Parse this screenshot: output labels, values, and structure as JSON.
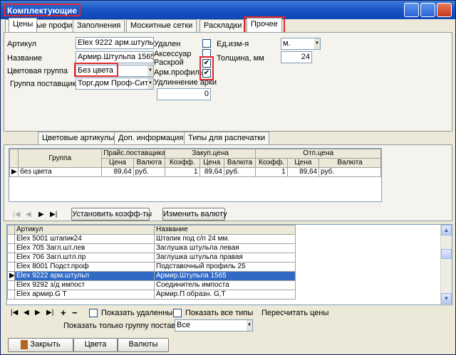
{
  "window": {
    "title": "Комплектующие"
  },
  "tabs": [
    "Основные профили",
    "Заполнения",
    "Москитные сетки",
    "Раскладки",
    "Прочее"
  ],
  "form": {
    "article_label": "Артикул",
    "article_value": "Elex 9222 арм.штульп",
    "name_label": "Название",
    "name_value": "Армир.Штульпа 1565",
    "color_group_label": "Цветовая группа",
    "color_group_value": "Без цвета",
    "supplier_group_label": "Группа поставщика",
    "supplier_group_value": "Торг.дом Проф-Сити",
    "deleted_label": "Удален",
    "accessory_label": "Аксессуар",
    "cutting_label": "Раскрой",
    "arm_profile_label": "Арм.профиль",
    "arc_extension_label": "Удлиннение арки",
    "arc_extension_value": "0",
    "unit_label": "Ед.изм-я",
    "unit_value": "м.",
    "thickness_label": "Толщина, мм",
    "thickness_value": "24",
    "deleted_checked": false,
    "accessory_checked": false,
    "cutting_checked": true,
    "arm_profile_checked": true
  },
  "subtabs": [
    "Цены",
    "Цветовые артикулы",
    "Доп. информация",
    "Типы для распечатки"
  ],
  "price_grid": {
    "group_header": "Группа",
    "supplier_price_header": "Прайс.поставщика",
    "purchase_price_header": "Закуп.цена",
    "sale_price_header": "Отп.цена",
    "price_col": "Цена",
    "currency_col": "Валюта",
    "coeff_col": "Коэфф.",
    "row": {
      "group": "без цвета",
      "supplier_price": "89,64",
      "supplier_currency": "руб.",
      "purchase_coeff": "1",
      "purchase_price": "89,64",
      "purchase_currency": "руб.",
      "sale_coeff": "1",
      "sale_price": "89,64",
      "sale_currency": "руб."
    }
  },
  "buttons": {
    "set_coeff": "Установить коэфф-ты",
    "change_currency": "Изменить валюту",
    "close": "Закрыть",
    "colors": "Цвета",
    "currencies": "Валюты"
  },
  "list": {
    "col_article": "Артикул",
    "col_name": "Название",
    "rows": [
      {
        "article": "Elex 5001 штапик24",
        "name": "Штапик под с/п 24 мм."
      },
      {
        "article": "Elex 705 Загл.шт.лев",
        "name": "Заглушка штульпа левая"
      },
      {
        "article": "Elex 706 Загл.штл.пр",
        "name": "Заглушка штульпа правая"
      },
      {
        "article": "Elex 8001 Подст.проф",
        "name": "Подставочный профиль 25"
      },
      {
        "article": "Elex 9222 арм.штульп",
        "name": "Армир.Штульпа 1565"
      },
      {
        "article": "Elex 9292 з/д импост",
        "name": "Соединитель импоста"
      },
      {
        "article": "Elex армир.G T",
        "name": "Армир.П образн. G,T"
      }
    ],
    "selected_index": 4
  },
  "bottom": {
    "show_deleted_label": "Показать удаленные",
    "show_all_types_label": "Показать все типы",
    "recalc_prices_label": "Пересчитать цены",
    "supplier_filter_label": "Показать только группу поставщика",
    "supplier_filter_value": "Все"
  },
  "colors": {
    "title_bar": "#1a56c8",
    "selection": "#316ac5",
    "highlight_box": "#e0282e"
  }
}
